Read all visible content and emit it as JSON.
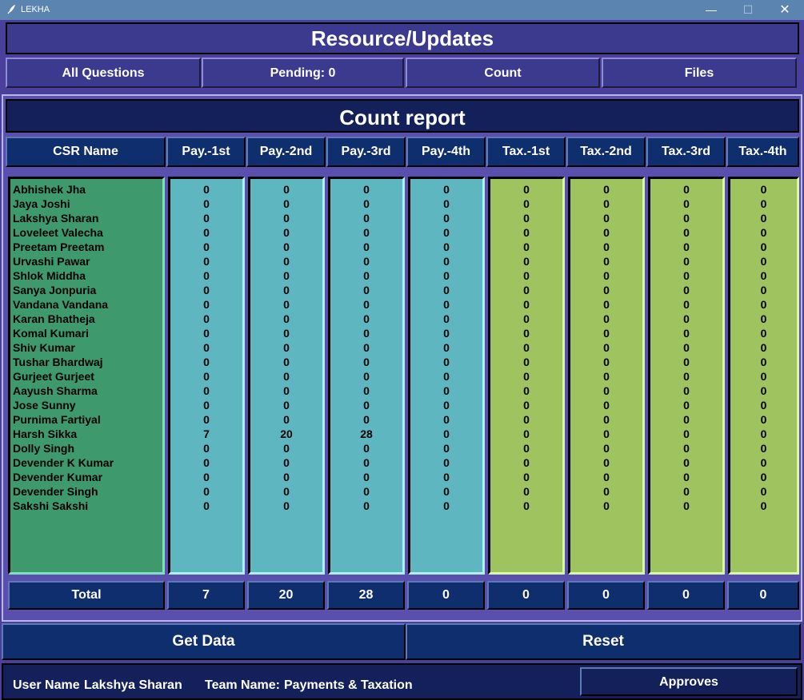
{
  "window": {
    "title": "LEKHA",
    "minimize_icon": "—",
    "maximize_icon": "☐",
    "close_icon": "✕"
  },
  "header": {
    "title": "Resource/Updates"
  },
  "nav": [
    {
      "label": "All Questions"
    },
    {
      "label": "Pending: 0"
    },
    {
      "label": "Count"
    },
    {
      "label": "Files"
    }
  ],
  "report": {
    "title": "Count report",
    "columns": [
      "CSR Name",
      "Pay.-1st",
      "Pay.-2nd",
      "Pay.-3rd",
      "Pay.-4th",
      "Tax.-1st",
      "Tax.-2nd",
      "Tax.-3rd",
      "Tax.-4th"
    ],
    "rows": [
      {
        "name": "Abhishek Jha",
        "values": [
          0,
          0,
          0,
          0,
          0,
          0,
          0,
          0
        ]
      },
      {
        "name": "Jaya Joshi",
        "values": [
          0,
          0,
          0,
          0,
          0,
          0,
          0,
          0
        ]
      },
      {
        "name": "Lakshya Sharan",
        "values": [
          0,
          0,
          0,
          0,
          0,
          0,
          0,
          0
        ]
      },
      {
        "name": "Loveleet Valecha",
        "values": [
          0,
          0,
          0,
          0,
          0,
          0,
          0,
          0
        ]
      },
      {
        "name": "Preetam Preetam",
        "values": [
          0,
          0,
          0,
          0,
          0,
          0,
          0,
          0
        ]
      },
      {
        "name": "Urvashi Pawar",
        "values": [
          0,
          0,
          0,
          0,
          0,
          0,
          0,
          0
        ]
      },
      {
        "name": "Shlok Middha",
        "values": [
          0,
          0,
          0,
          0,
          0,
          0,
          0,
          0
        ]
      },
      {
        "name": "Sanya Jonpuria",
        "values": [
          0,
          0,
          0,
          0,
          0,
          0,
          0,
          0
        ]
      },
      {
        "name": "Vandana Vandana",
        "values": [
          0,
          0,
          0,
          0,
          0,
          0,
          0,
          0
        ]
      },
      {
        "name": "Karan Bhatheja",
        "values": [
          0,
          0,
          0,
          0,
          0,
          0,
          0,
          0
        ]
      },
      {
        "name": "Komal Kumari",
        "values": [
          0,
          0,
          0,
          0,
          0,
          0,
          0,
          0
        ]
      },
      {
        "name": "Shiv Kumar",
        "values": [
          0,
          0,
          0,
          0,
          0,
          0,
          0,
          0
        ]
      },
      {
        "name": "Tushar Bhardwaj",
        "values": [
          0,
          0,
          0,
          0,
          0,
          0,
          0,
          0
        ]
      },
      {
        "name": "Gurjeet Gurjeet",
        "values": [
          0,
          0,
          0,
          0,
          0,
          0,
          0,
          0
        ]
      },
      {
        "name": "Aayush Sharma",
        "values": [
          0,
          0,
          0,
          0,
          0,
          0,
          0,
          0
        ]
      },
      {
        "name": "Jose Sunny",
        "values": [
          0,
          0,
          0,
          0,
          0,
          0,
          0,
          0
        ]
      },
      {
        "name": "Purnima Fartiyal",
        "values": [
          0,
          0,
          0,
          0,
          0,
          0,
          0,
          0
        ]
      },
      {
        "name": "Harsh Sikka",
        "values": [
          7,
          20,
          28,
          0,
          0,
          0,
          0,
          0
        ]
      },
      {
        "name": "Dolly Singh",
        "values": [
          0,
          0,
          0,
          0,
          0,
          0,
          0,
          0
        ]
      },
      {
        "name": "Devender K Kumar",
        "values": [
          0,
          0,
          0,
          0,
          0,
          0,
          0,
          0
        ]
      },
      {
        "name": "Devender Kumar",
        "values": [
          0,
          0,
          0,
          0,
          0,
          0,
          0,
          0
        ]
      },
      {
        "name": "Devender Singh",
        "values": [
          0,
          0,
          0,
          0,
          0,
          0,
          0,
          0
        ]
      },
      {
        "name": "Sakshi Sakshi",
        "values": [
          0,
          0,
          0,
          0,
          0,
          0,
          0,
          0
        ]
      }
    ],
    "total_label": "Total",
    "totals": [
      7,
      20,
      28,
      0,
      0,
      0,
      0,
      0
    ]
  },
  "actions": {
    "get_data": "Get Data",
    "reset": "Reset"
  },
  "footer": {
    "user_label": "User Name",
    "user_value": "Lakshya Sharan",
    "team_label": "Team Name:",
    "team_value": "Payments & Taxation",
    "approves": "Approves"
  },
  "colors": {
    "names_column": "#3e9a6c",
    "pay_columns": "#5db6c0",
    "tax_columns": "#9fc35e",
    "header_bar": "#3c3a8f",
    "dark_navy": "#13205a"
  }
}
